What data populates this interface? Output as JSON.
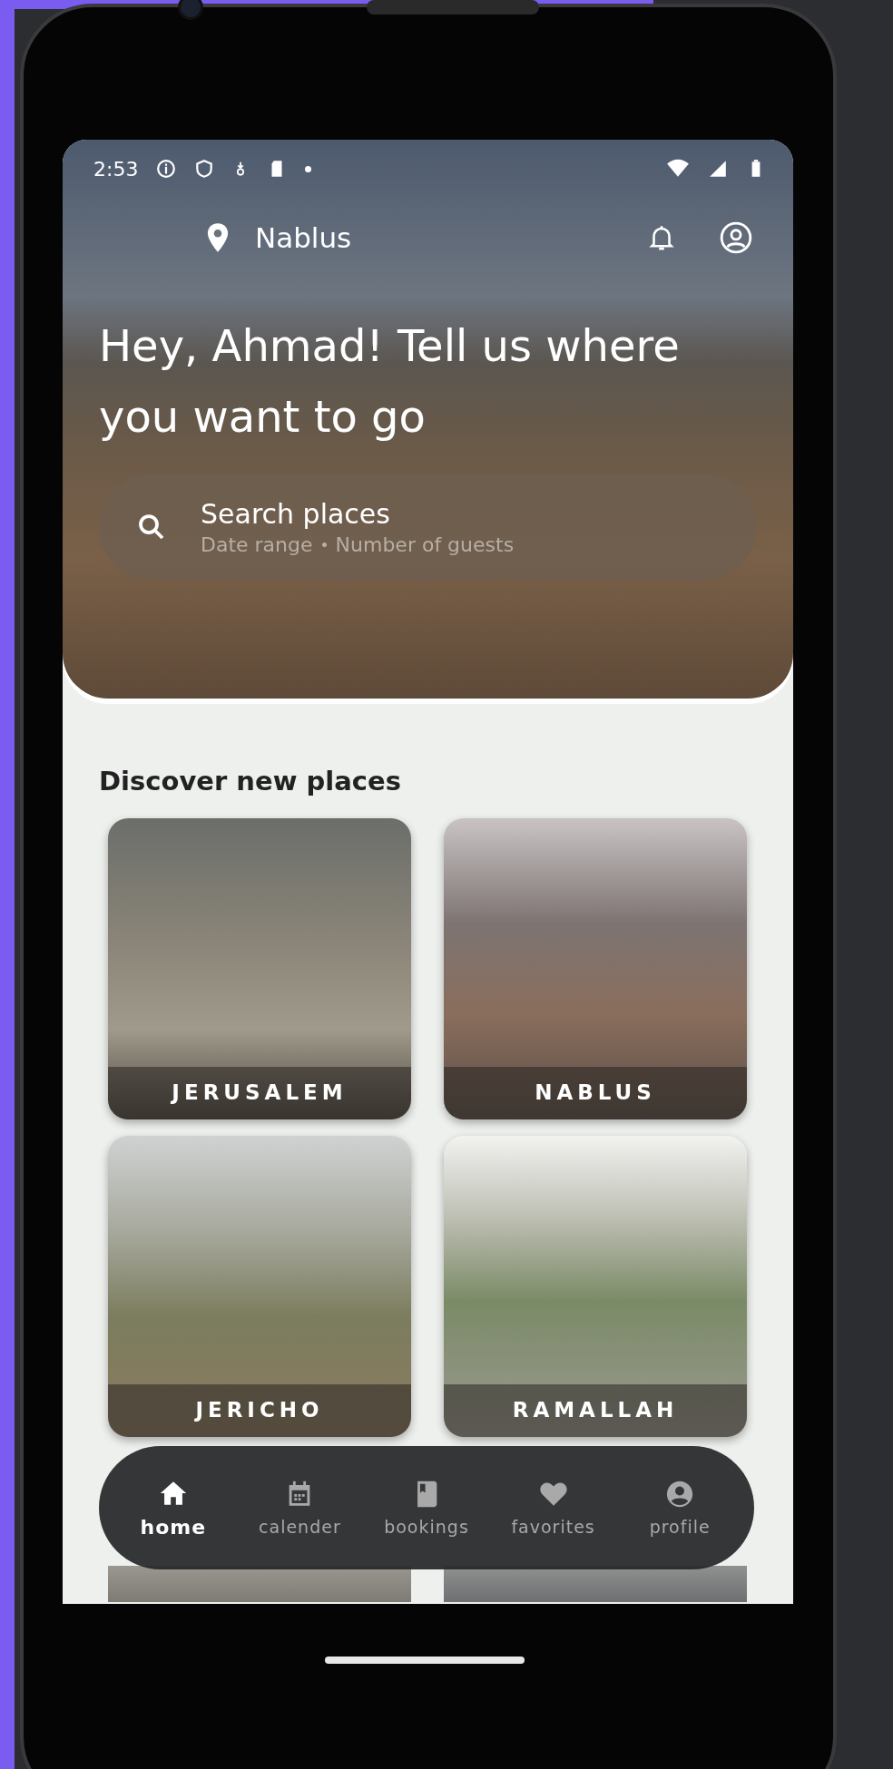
{
  "status_bar": {
    "time": "2:53"
  },
  "header": {
    "location": "Nablus"
  },
  "hero": {
    "headline": "Hey, Ahmad! Tell us where you want to go",
    "search": {
      "placeholder": "Search places",
      "hints": [
        "Date range",
        "Number of guests"
      ]
    }
  },
  "discover": {
    "title": "Discover new places",
    "places": [
      {
        "name": "JERUSALEM"
      },
      {
        "name": "NABLUS"
      },
      {
        "name": "JERICHO"
      },
      {
        "name": "RAMALLAH"
      }
    ]
  },
  "bottom_nav": [
    {
      "label": "home",
      "selected": true
    },
    {
      "label": "calender",
      "selected": false
    },
    {
      "label": "bookings",
      "selected": false
    },
    {
      "label": "favorites",
      "selected": false
    },
    {
      "label": "profile",
      "selected": false
    }
  ]
}
